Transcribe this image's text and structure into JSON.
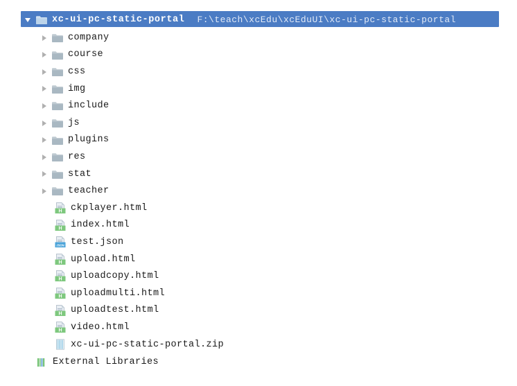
{
  "root": {
    "name": "xc-ui-pc-static-portal",
    "path": "F:\\teach\\xcEdu\\xcEduUI\\xc-ui-pc-static-portal",
    "expanded": true,
    "arrow_icon": "triangle-down-icon",
    "folder_icon": "folder-icon",
    "selected_color": "#4b7cc4",
    "selected_text_color": "#ffffff"
  },
  "colors": {
    "folder_icon": "#a9b8c2",
    "html_badge": "#7ec87e",
    "json_badge": "#4aa3d9",
    "zip_stripes": "#9fd0e8",
    "library_bars_1": "#6ec06e",
    "library_bars_2": "#8fd08f",
    "library_bars_3": "#6fa8d8",
    "text": "#1a1a1a",
    "arrow": "#b0b0b0"
  },
  "tree": [
    {
      "label": "company",
      "kind": "folder",
      "icon": "folder-icon",
      "arrow_icon": "triangle-right-icon",
      "expanded": false
    },
    {
      "label": "course",
      "kind": "folder",
      "icon": "folder-icon",
      "arrow_icon": "triangle-right-icon",
      "expanded": false
    },
    {
      "label": "css",
      "kind": "folder",
      "icon": "folder-icon",
      "arrow_icon": "triangle-right-icon",
      "expanded": false
    },
    {
      "label": "img",
      "kind": "folder",
      "icon": "folder-icon",
      "arrow_icon": "triangle-right-icon",
      "expanded": false
    },
    {
      "label": "include",
      "kind": "folder",
      "icon": "folder-icon",
      "arrow_icon": "triangle-right-icon",
      "expanded": false
    },
    {
      "label": "js",
      "kind": "folder",
      "icon": "folder-icon",
      "arrow_icon": "triangle-right-icon",
      "expanded": false
    },
    {
      "label": "plugins",
      "kind": "folder",
      "icon": "folder-icon",
      "arrow_icon": "triangle-right-icon",
      "expanded": false
    },
    {
      "label": "res",
      "kind": "folder",
      "icon": "folder-icon",
      "arrow_icon": "triangle-right-icon",
      "expanded": false
    },
    {
      "label": "stat",
      "kind": "folder",
      "icon": "folder-icon",
      "arrow_icon": "triangle-right-icon",
      "expanded": false
    },
    {
      "label": "teacher",
      "kind": "folder",
      "icon": "folder-icon",
      "arrow_icon": "triangle-right-icon",
      "expanded": false
    },
    {
      "label": "ckplayer.html",
      "kind": "file",
      "icon": "html-file-icon",
      "badge": "H"
    },
    {
      "label": "index.html",
      "kind": "file",
      "icon": "html-file-icon",
      "badge": "H"
    },
    {
      "label": "test.json",
      "kind": "file",
      "icon": "json-file-icon",
      "badge": "JSON"
    },
    {
      "label": "upload.html",
      "kind": "file",
      "icon": "html-file-icon",
      "badge": "H"
    },
    {
      "label": "uploadcopy.html",
      "kind": "file",
      "icon": "html-file-icon",
      "badge": "H"
    },
    {
      "label": "uploadmulti.html",
      "kind": "file",
      "icon": "html-file-icon",
      "badge": "H"
    },
    {
      "label": "uploadtest.html",
      "kind": "file",
      "icon": "html-file-icon",
      "badge": "H"
    },
    {
      "label": "video.html",
      "kind": "file",
      "icon": "html-file-icon",
      "badge": "H"
    },
    {
      "label": "xc-ui-pc-static-portal.zip",
      "kind": "file",
      "icon": "zip-file-icon",
      "badge": ""
    }
  ],
  "library": {
    "label": "External Libraries",
    "icon": "library-icon"
  }
}
